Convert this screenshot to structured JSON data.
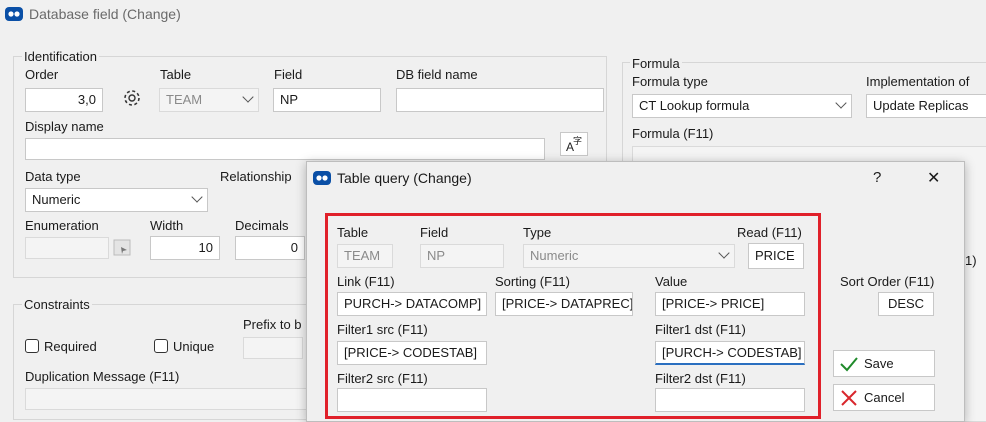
{
  "main": {
    "title": "Database field (Change)",
    "identification": {
      "title": "Identification",
      "order_label": "Order",
      "order_value": "3,0",
      "table_label": "Table",
      "table_value": "TEAM",
      "field_label": "Field",
      "field_value": "NP",
      "dbfield_label": "DB field name",
      "dbfield_value": "",
      "display_label": "Display name",
      "display_value": "",
      "datatype_label": "Data type",
      "datatype_value": "Numeric",
      "relationship_label": "Relationship",
      "enumeration_label": "Enumeration",
      "enumeration_value": "",
      "width_label": "Width",
      "width_value": "10",
      "decimals_label": "Decimals",
      "decimals_value": "0"
    },
    "constraints": {
      "title": "Constraints",
      "required_label": "Required",
      "unique_label": "Unique",
      "prefix_label": "Prefix to b",
      "dup_label": "Duplication Message (F11)"
    },
    "formula": {
      "title": "Formula",
      "type_label": "Formula type",
      "type_value": "CT Lookup formula",
      "impl_label": "Implementation of",
      "impl_value": "Update Replicas",
      "formula_label": "Formula (F11)",
      "partial_text": "1)"
    }
  },
  "dialog": {
    "title": "Table query (Change)",
    "help": "?",
    "close": "✕",
    "table_label": "Table",
    "table_value": "TEAM",
    "field_label": "Field",
    "field_value": "NP",
    "type_label": "Type",
    "type_value": "Numeric",
    "read_label": "Read (F11)",
    "read_value": "PRICE",
    "link_label": "Link (F11)",
    "link_value": "PURCH-> DATACOMP]",
    "sorting_label": "Sorting (F11)",
    "sorting_value": "[PRICE-> DATAPREC]",
    "value_label": "Value",
    "value_value": "[PRICE-> PRICE]",
    "sortorder_label": "Sort Order (F11)",
    "sortorder_value": "DESC",
    "f1src_label": "Filter1 src (F11)",
    "f1src_value": "[PRICE-> CODESTAB]",
    "f1dst_label": "Filter1 dst (F11)",
    "f1dst_value": "[PURCH-> CODESTAB]",
    "f2src_label": "Filter2 src (F11)",
    "f2src_value": "",
    "f2dst_label": "Filter2 dst (F11)",
    "f2dst_value": "",
    "save_label": "Save",
    "cancel_label": "Cancel",
    "highlight_color": "#e0202a"
  }
}
